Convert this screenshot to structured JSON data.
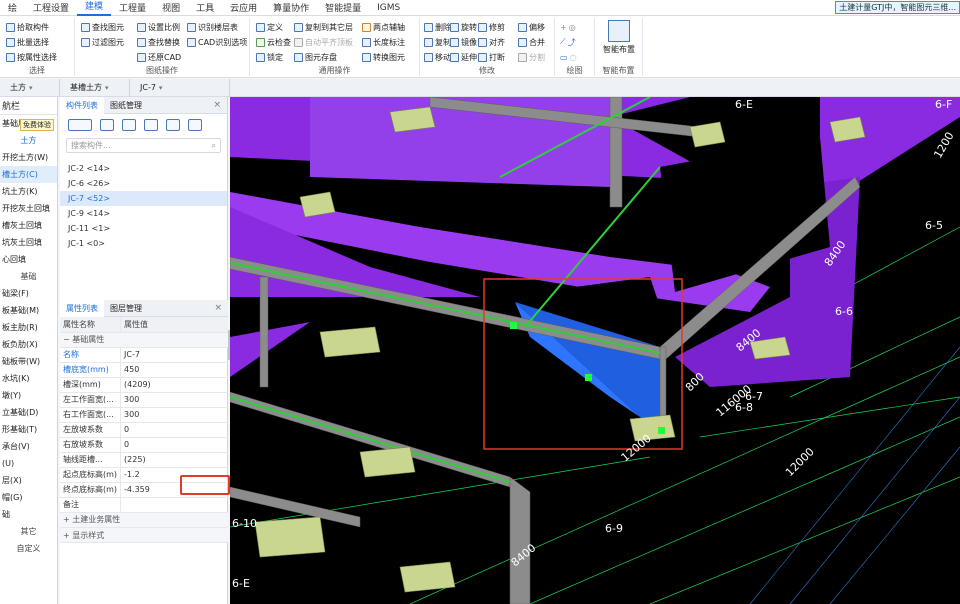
{
  "menubar": {
    "items": [
      "绘",
      "工程设置",
      "建模",
      "工程量",
      "视图",
      "工具",
      "云应用",
      "算量协作",
      "智能提量",
      "IGMS"
    ],
    "active_index": 2,
    "notice": "土建计量GTJ中，智能图元三维..."
  },
  "ribbon": {
    "select_group": {
      "title": "选择",
      "buttons": [
        "拾取构件",
        "批量选择",
        "按属性选择"
      ]
    },
    "drawing_group": {
      "title": "图纸操作",
      "buttons": [
        "查找图元",
        "过滤图元",
        "设置比例",
        "查找替换",
        "还原CAD",
        "识别楼层表",
        "CAD识别选项"
      ]
    },
    "general_group": {
      "title": "通用操作",
      "buttons": [
        "定义",
        "云检查",
        "锁定",
        "复制到其它层",
        "自动平齐顶板",
        "图元存盘",
        "两点辅轴",
        "长度标注",
        "转换图元"
      ]
    },
    "modify_group": {
      "title": "修改",
      "buttons": [
        "删除",
        "复制",
        "移动",
        "旋转",
        "镜像",
        "延伸",
        "修剪",
        "对齐",
        "打断",
        "偏移",
        "合并",
        "分割"
      ]
    },
    "draw_group": {
      "title": "绘图"
    },
    "smart_group": {
      "title": "智能布置",
      "button": "智能布置"
    }
  },
  "selector_bar": {
    "items": [
      "土方",
      "基槽土方",
      "JC-7"
    ]
  },
  "left_nav": {
    "header": "航栏",
    "tooltip": "免费体验",
    "items": [
      {
        "label": "基础层",
        "type": "item"
      },
      {
        "label": "土方",
        "type": "cat",
        "selected": true
      },
      {
        "label": "开挖土方(W)",
        "type": "item"
      },
      {
        "label": "槽土方(C)",
        "type": "item",
        "active": true
      },
      {
        "label": "坑土方(K)",
        "type": "item"
      },
      {
        "label": "开挖灰土回填",
        "type": "item"
      },
      {
        "label": "槽灰土回填",
        "type": "item"
      },
      {
        "label": "坑灰土回填",
        "type": "item"
      },
      {
        "label": "心回填",
        "type": "item"
      },
      {
        "label": "基础",
        "type": "cat"
      },
      {
        "label": "础梁(F)",
        "type": "item"
      },
      {
        "label": "板基础(M)",
        "type": "item"
      },
      {
        "label": "板主肋(R)",
        "type": "item"
      },
      {
        "label": "板负肋(X)",
        "type": "item"
      },
      {
        "label": "础板带(W)",
        "type": "item"
      },
      {
        "label": "水坑(K)",
        "type": "item"
      },
      {
        "label": "墩(Y)",
        "type": "item"
      },
      {
        "label": "立基础(D)",
        "type": "item"
      },
      {
        "label": "形基础(T)",
        "type": "item"
      },
      {
        "label": "承台(V)",
        "type": "item"
      },
      {
        "label": "(U)",
        "type": "item"
      },
      {
        "label": "层(X)",
        "type": "item"
      },
      {
        "label": "帽(G)",
        "type": "item"
      },
      {
        "label": "础",
        "type": "item"
      },
      {
        "label": "其它",
        "type": "cat"
      },
      {
        "label": "自定义",
        "type": "cat"
      }
    ]
  },
  "component_panel": {
    "tabs": [
      "构件列表",
      "图纸管理"
    ],
    "search_placeholder": "搜索构件...",
    "items": [
      "JC-2 <14>",
      "JC-6 <26>",
      "JC-7 <52>",
      "JC-9 <14>",
      "JC-11 <1>",
      "JC-1 <0>"
    ],
    "selected_index": 2
  },
  "property_panel": {
    "tabs": [
      "属性列表",
      "图层管理"
    ],
    "col_name": "属性名称",
    "col_value": "属性值",
    "group_basic": "基础属性",
    "rows": [
      {
        "name": "名称",
        "value": "JC-7",
        "blue": true
      },
      {
        "name": "槽底宽(mm)",
        "value": "450",
        "blue": true
      },
      {
        "name": "槽深(mm)",
        "value": "(4209)",
        "blue": false
      },
      {
        "name": "左工作面宽(...",
        "value": "300",
        "blue": false
      },
      {
        "name": "右工作面宽(...",
        "value": "300",
        "blue": false
      },
      {
        "name": "左放坡系数",
        "value": "0",
        "blue": false
      },
      {
        "name": "右放坡系数",
        "value": "0",
        "blue": false
      },
      {
        "name": "轴线距槽...",
        "value": "(225)",
        "blue": false
      },
      {
        "name": "起点底标高(m)",
        "value": "-1.2",
        "blue": false
      },
      {
        "name": "终点底标高(m)",
        "value": "-4.359",
        "blue": false
      },
      {
        "name": "备注",
        "value": "",
        "blue": false
      }
    ],
    "group_civil": "土建业务属性",
    "group_display": "显示样式"
  },
  "viewport": {
    "axis_labels": [
      "6-E",
      "6-F",
      "6-5",
      "6-6",
      "6-7",
      "6-8",
      "6-9",
      "6-10",
      "6-E"
    ],
    "dims": [
      "8400",
      "8400",
      "800",
      "116000",
      "12000",
      "12000",
      "8400",
      "1200"
    ],
    "colors": {
      "slab": "#8a2be2",
      "selected": "#1f5fe0",
      "beam": "#8c8c8c",
      "rebar": "#2fcf3a",
      "footing": "#c8d690",
      "grid": "#1bd65a",
      "highlight": "#e23a2a"
    }
  }
}
